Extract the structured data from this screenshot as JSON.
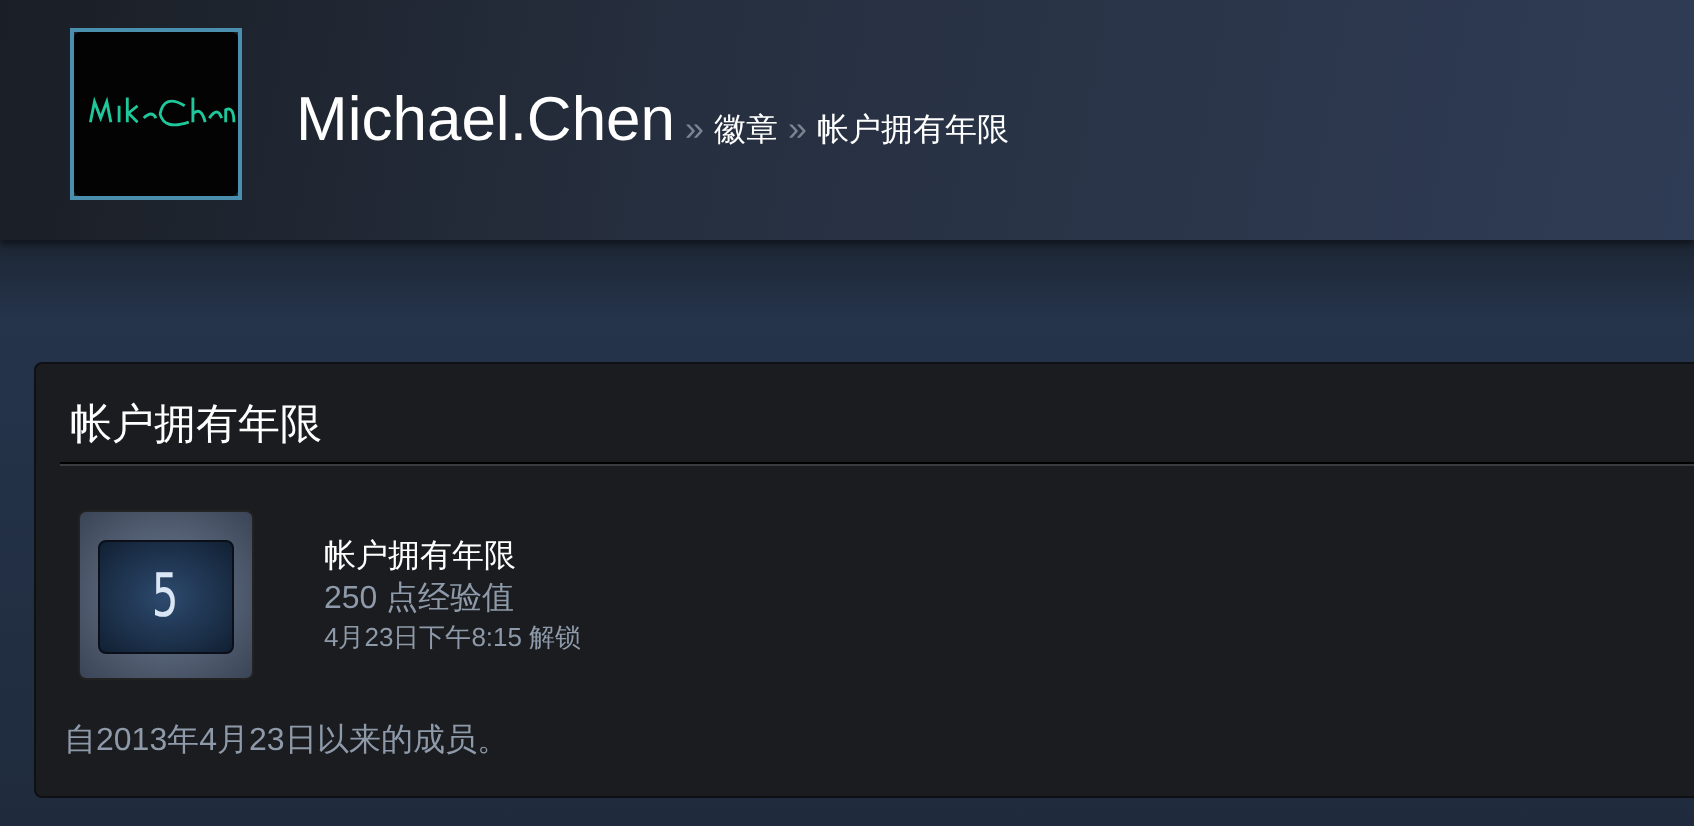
{
  "header": {
    "user_name": "Michael.Chen",
    "breadcrumbs": [
      {
        "separator": "»",
        "label": "徽章"
      },
      {
        "separator": "»",
        "label": "帐户拥有年限"
      }
    ]
  },
  "card": {
    "title": "帐户拥有年限",
    "badge": {
      "number": "5",
      "name": "帐户拥有年限",
      "xp": "250 点经验值",
      "unlocked": "4月23日下午8:15 解锁"
    },
    "description": "自2013年4月23日以来的成员。"
  }
}
